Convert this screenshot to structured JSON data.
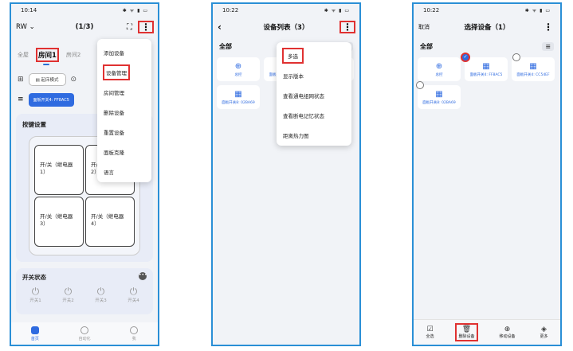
{
  "screens": {
    "p1": {
      "status_time": "10:14",
      "status_icons": "✱ ᯤ ▮ ▭",
      "header_left": "RW ⌄",
      "header_center": "(1/3)",
      "rooms": [
        "全屋",
        "房间1",
        "房间2"
      ],
      "mode_chip": "起床模式",
      "mode_more": "回家",
      "device_chip": "面板开关4: FF8AC5",
      "button_settings_title": "按键设置",
      "buttons": [
        "开/关（继电器1）",
        "开/关（继电器2）",
        "开/关（继电器3）",
        "开/关（继电器4）"
      ],
      "switch_status_title": "开关状态",
      "switches": [
        "开关1",
        "开关2",
        "开关3",
        "开关4"
      ],
      "nav": [
        "首页",
        "自动化",
        "我"
      ],
      "menu": [
        "添加设备",
        "设备管理",
        "房间管理",
        "删除设备",
        "重置设备",
        "面板克隆",
        "语言"
      ]
    },
    "p2": {
      "status_time": "10:22",
      "status_icons": "✱ ᯤ ▮ ▭",
      "title": "设备列表（3）",
      "section": "全部",
      "devices": [
        {
          "name": "总控",
          "glyph": "⊕"
        },
        {
          "name": "面板开关4: FF8AC5",
          "glyph": "▦"
        },
        {
          "name": "面板开关4: CC54EF",
          "glyph": "▦"
        },
        {
          "name": "面板开关8: 02BA69",
          "glyph": "▦"
        }
      ],
      "menu": [
        "多选",
        "显示版本",
        "查看通电组网状态",
        "查看断电记忆状态",
        "距离热力图"
      ]
    },
    "p3": {
      "status_time": "10:22",
      "status_icons": "✱ ᯤ ▮ ▭",
      "cancel": "取消",
      "title": "选择设备（1）",
      "section": "全部",
      "devices": [
        {
          "name": "总控",
          "glyph": "⊕"
        },
        {
          "name": "面板开关4: FF8AC5",
          "glyph": "▦"
        },
        {
          "name": "面板开关4: CC54EF",
          "glyph": "▦"
        },
        {
          "name": "面板开关8: 02BA69",
          "glyph": "▦"
        }
      ],
      "bottom": [
        {
          "label": "全选",
          "glyph": "☑"
        },
        {
          "label": "删除设备",
          "glyph": "🗑"
        },
        {
          "label": "移动设备",
          "glyph": "⊕"
        },
        {
          "label": "更多",
          "glyph": "◈"
        }
      ]
    }
  },
  "colors": {
    "accent": "#2f6be0",
    "frame": "#2a8fd6",
    "highlight": "#e03131"
  }
}
